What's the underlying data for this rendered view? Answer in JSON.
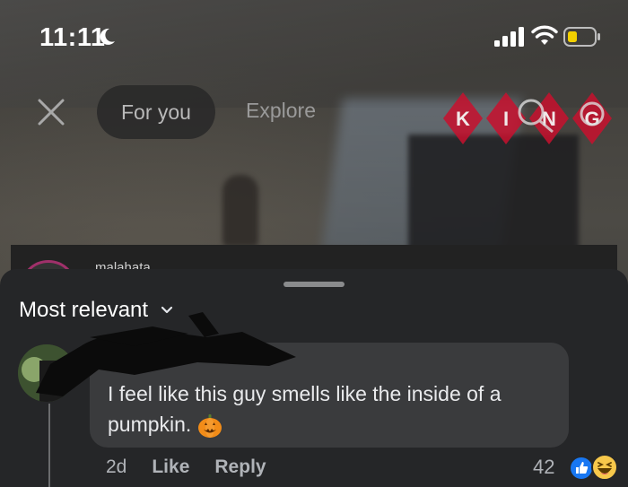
{
  "status_bar": {
    "time": "11:11",
    "focus_icon": "moon-icon",
    "signal_icon": "signal-icon",
    "wifi_icon": "wifi-icon",
    "battery_icon": "battery-icon",
    "battery_color": "#f2d000"
  },
  "top_nav": {
    "close_icon": "close-icon",
    "tabs": [
      {
        "label": "For you",
        "active": true
      },
      {
        "label": "Explore",
        "active": false
      }
    ]
  },
  "watermark": {
    "letters": [
      "K",
      "I",
      "N",
      "G"
    ],
    "color": "#c8102e"
  },
  "post": {
    "username": "malahata"
  },
  "comments_sheet": {
    "sort_label": "Most relevant",
    "comment": {
      "author": "",
      "text": "I feel like this guy smells like the inside of a pumpkin.",
      "emoji": "pumpkin-icon",
      "time": "2d",
      "like_label": "Like",
      "reply_label": "Reply",
      "reaction_count": "42",
      "reactions": [
        "like-reaction-icon",
        "haha-reaction-icon"
      ]
    }
  },
  "colors": {
    "sheet_bg": "#252628",
    "bubble_bg": "#3a3b3d",
    "like_blue": "#1877f2",
    "haha_yellow": "#f7c84b"
  }
}
